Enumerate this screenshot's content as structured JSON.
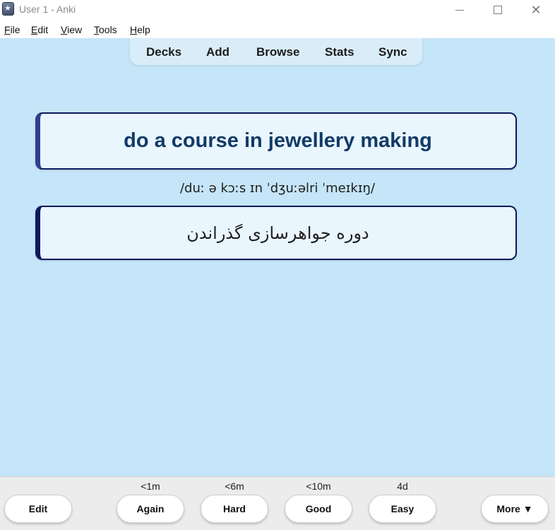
{
  "window": {
    "title": "User 1 - Anki",
    "app_icon": "anki-star-icon",
    "controls": {
      "minimize": "minimize-icon",
      "maximize": "maximize-icon",
      "close": "✕"
    }
  },
  "menu": {
    "items": [
      {
        "first": "F",
        "rest": "ile"
      },
      {
        "first": "E",
        "rest": "dit"
      },
      {
        "first": "V",
        "rest": "iew"
      },
      {
        "first": "T",
        "rest": "ools"
      },
      {
        "first": "H",
        "rest": "elp"
      }
    ]
  },
  "toolbar": {
    "links": [
      "Decks",
      "Add",
      "Browse",
      "Stats",
      "Sync"
    ]
  },
  "card": {
    "front": "do a course in jewellery making",
    "pronunciation": "/duː ə kɔːs ɪn ˈdʒuːəlri ˈmeɪkɪŋ/",
    "back": "دوره جواهرسازی گذراندن"
  },
  "bottom": {
    "edit_label": "Edit",
    "answers": [
      {
        "label": "Again",
        "interval": "<1m"
      },
      {
        "label": "Hard",
        "interval": "<6m"
      },
      {
        "label": "Good",
        "interval": "<10m"
      },
      {
        "label": "Easy",
        "interval": "4d"
      }
    ],
    "more_label": "More ▼"
  },
  "colors": {
    "background": "#c5e5f8",
    "card_fill": "#eaf6fe",
    "card_border": "#0c1a5c",
    "front_text": "#123a66"
  }
}
